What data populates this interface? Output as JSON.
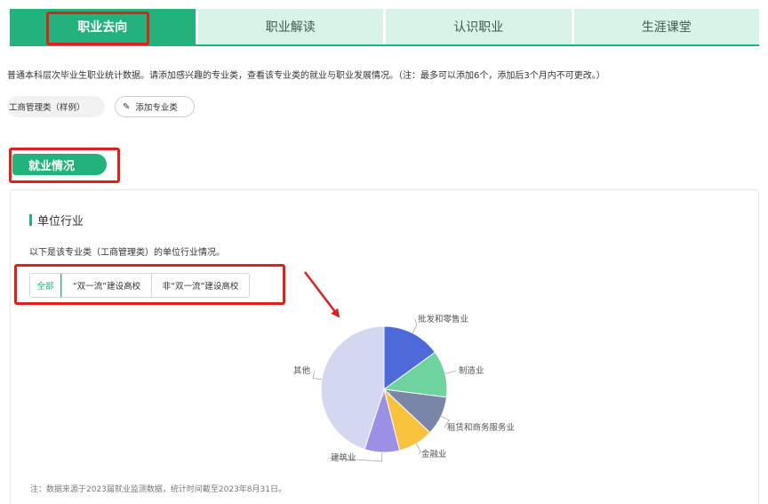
{
  "tabs": [
    {
      "label": "职业去向",
      "active": true
    },
    {
      "label": "职业解读",
      "active": false
    },
    {
      "label": "认识职业",
      "active": false
    },
    {
      "label": "生涯课堂",
      "active": false
    }
  ],
  "description": "普通本科层次毕业生职业统计数据。请添加感兴趣的专业类，查看该专业类的就业与职业发展情况。（注：最多可以添加6个，添加后3个月内不可更改。）",
  "chips": {
    "sample": "工商管理类（样例）",
    "add_icon": "pencil-icon",
    "add_label": "添加专业类"
  },
  "section_title": "就业情况",
  "card": {
    "title": "单位行业",
    "description": "以下是该专业类（工商管理类）的单位行业情况。",
    "filters": [
      {
        "label": "全部",
        "active": true
      },
      {
        "label": "“双一流”建设高校",
        "active": false
      },
      {
        "label": "非“双一流”建设高校",
        "active": false
      }
    ],
    "note": "注：数据来源于2023届就业监测数据，统计时间截至2023年8月31日。"
  },
  "annotation_colors": {
    "highlight": "#e0201c",
    "accent": "#22b27b"
  },
  "chart_data": {
    "type": "pie",
    "slices": [
      {
        "label": "批发和零售业",
        "value": 15,
        "color": "#4d6ad8"
      },
      {
        "label": "制造业",
        "value": 12,
        "color": "#6fd3a0"
      },
      {
        "label": "租赁和商务服务业",
        "value": 10,
        "color": "#7a86a8"
      },
      {
        "label": "金融业",
        "value": 9,
        "color": "#f9c23c"
      },
      {
        "label": "建筑业",
        "value": 9,
        "color": "#9b8fe6"
      },
      {
        "label": "其他",
        "value": 45,
        "color": "#d3d8f0"
      }
    ]
  }
}
